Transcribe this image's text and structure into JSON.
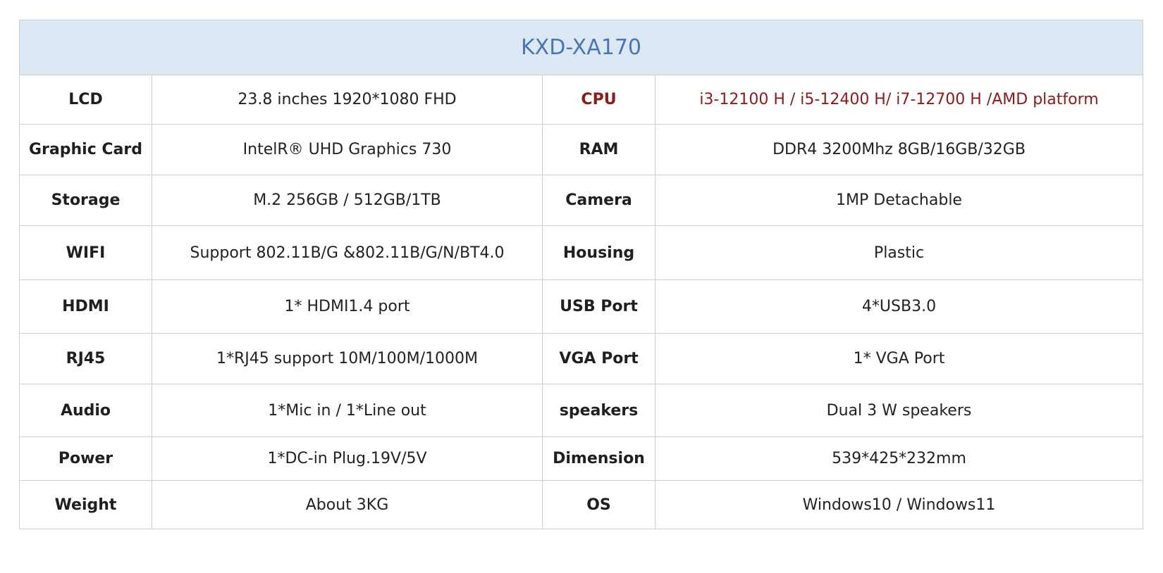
{
  "title": "KXD-XA170",
  "colors": {
    "title_background": "#dce9f5",
    "title_text": "#4a75b5",
    "highlight_text": "#8b1a1a",
    "border": "#cfcfcf"
  },
  "rows": [
    {
      "label1": "LCD",
      "value1": "23.8 inches 1920*1080 FHD",
      "label2": "CPU",
      "value2": "i3-12100 H / i5-12400 H/ i7-12700 H /AMD platform"
    },
    {
      "label1": "Graphic Card",
      "value1": "IntelR® UHD Graphics 730",
      "label2": "RAM",
      "value2": "DDR4 3200Mhz 8GB/16GB/32GB"
    },
    {
      "label1": "Storage",
      "value1": "M.2 256GB / 512GB/1TB",
      "label2": "Camera",
      "value2": "1MP Detachable"
    },
    {
      "label1": "WIFI",
      "value1": "Support 802.11B/G &802.11B/G/N/BT4.0",
      "label2": "Housing",
      "value2": "Plastic"
    },
    {
      "label1": "HDMI",
      "value1": "1* HDMI1.4 port",
      "label2": "USB Port",
      "value2": "4*USB3.0"
    },
    {
      "label1": "RJ45",
      "value1": "1*RJ45 support 10M/100M/1000M",
      "label2": "VGA Port",
      "value2": "1* VGA Port"
    },
    {
      "label1": "Audio",
      "value1": "1*Mic in / 1*Line out",
      "label2": "speakers",
      "value2": "Dual 3 W speakers"
    },
    {
      "label1": "Power",
      "value1": "1*DC-in Plug.19V/5V",
      "label2": "Dimension",
      "value2": "539*425*232mm"
    },
    {
      "label1": "Weight",
      "value1": "About 3KG",
      "label2": "OS",
      "value2": "Windows10 / Windows11"
    }
  ]
}
